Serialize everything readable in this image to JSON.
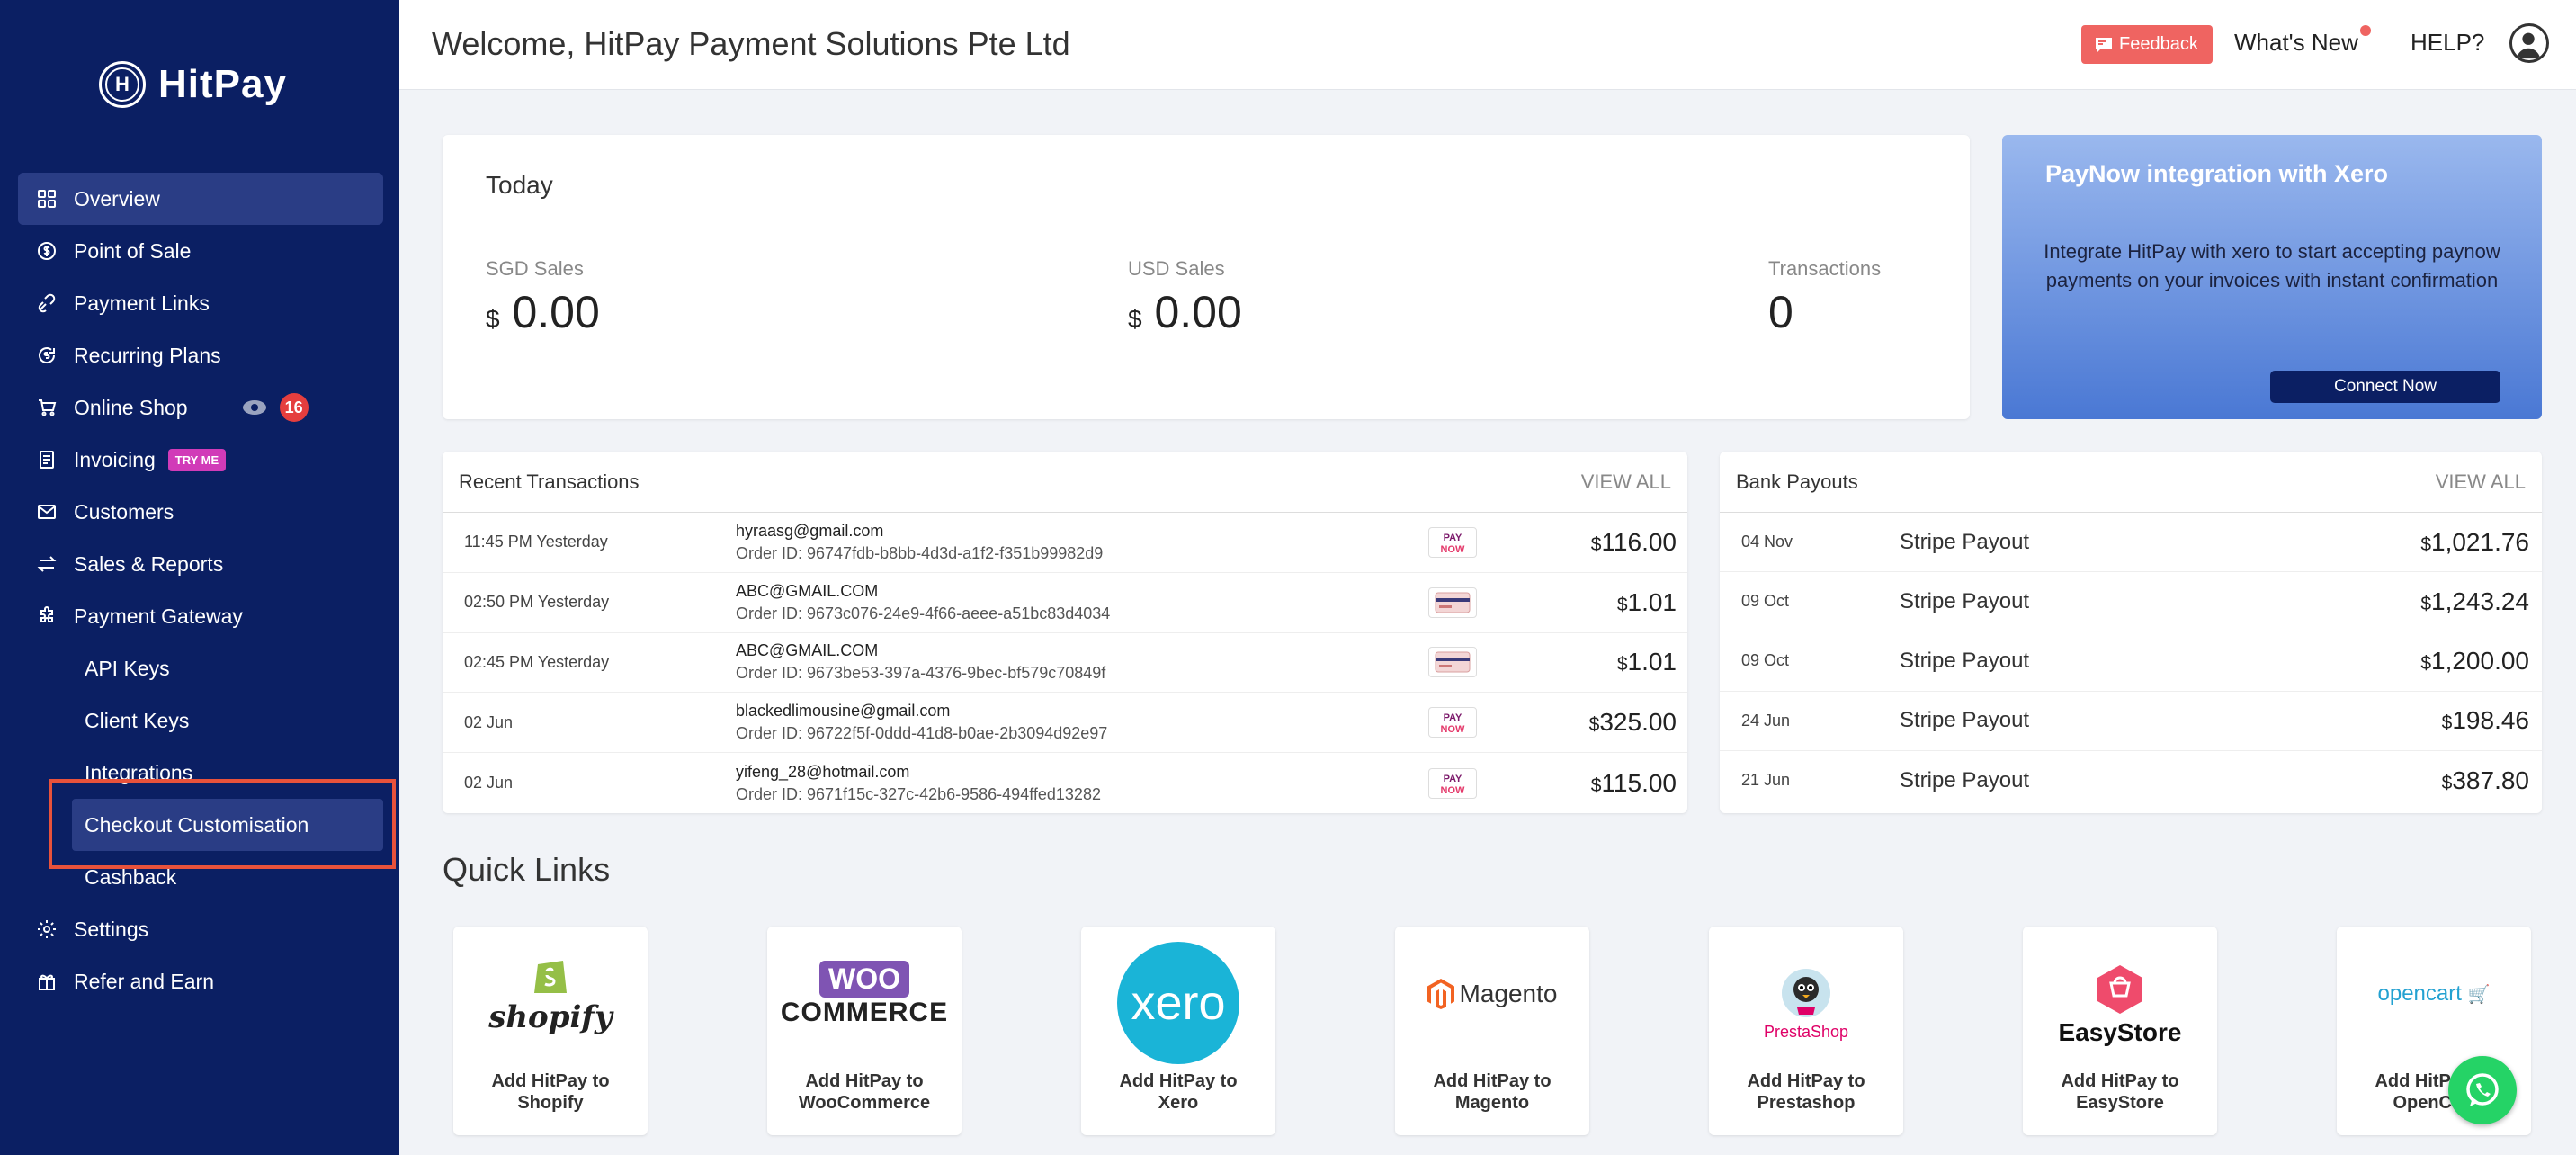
{
  "brand": {
    "name": "HitPay",
    "mark": "H"
  },
  "sidebar": {
    "items": [
      {
        "label": "Overview",
        "icon": "grid-icon"
      },
      {
        "label": "Point of Sale",
        "icon": "dollar-circle-icon"
      },
      {
        "label": "Payment Links",
        "icon": "link-icon"
      },
      {
        "label": "Recurring Plans",
        "icon": "recurring-icon"
      },
      {
        "label": "Online Shop",
        "icon": "cart-icon",
        "badge": "16"
      },
      {
        "label": "Invoicing",
        "icon": "invoice-icon",
        "tag": "TRY ME"
      },
      {
        "label": "Customers",
        "icon": "mail-icon"
      },
      {
        "label": "Sales & Reports",
        "icon": "arrows-icon"
      },
      {
        "label": "Payment Gateway",
        "icon": "puzzle-icon"
      }
    ],
    "sub_items": [
      "API Keys",
      "Client Keys",
      "Integrations",
      "Checkout Customisation",
      "Cashback"
    ],
    "bottom_items": [
      {
        "label": "Settings",
        "icon": "gear-icon"
      },
      {
        "label": "Refer and Earn",
        "icon": "gift-icon"
      }
    ]
  },
  "header": {
    "welcome": "Welcome, HitPay Payment Solutions Pte Ltd",
    "feedback": "Feedback",
    "whats_new": "What's New",
    "help": "HELP?"
  },
  "today": {
    "title": "Today",
    "sgd_label": "SGD Sales",
    "sgd_currency": "$",
    "sgd_value": "0.00",
    "usd_label": "USD Sales",
    "usd_currency": "$",
    "usd_value": "0.00",
    "tx_label": "Transactions",
    "tx_value": "0"
  },
  "promo": {
    "title": "PayNow integration with Xero",
    "body": "Integrate HitPay with xero to start accepting paynow payments on your invoices with instant confirmation",
    "button": "Connect Now"
  },
  "transactions": {
    "title": "Recent Transactions",
    "view_all": "VIEW ALL",
    "order_prefix": "Order ID: ",
    "rows": [
      {
        "time": "11:45 PM Yesterday",
        "email": "hyraasg@gmail.com",
        "order": "96747fdb-b8bb-4d3d-a1f2-f351b99982d9",
        "method": "paynow",
        "cur": "$",
        "amount": "116.00"
      },
      {
        "time": "02:50 PM Yesterday",
        "email": "ABC@GMAIL.COM",
        "order": "9673c076-24e9-4f66-aeee-a51bc83d4034",
        "method": "card",
        "cur": "$",
        "amount": "1.01"
      },
      {
        "time": "02:45 PM Yesterday",
        "email": "ABC@GMAIL.COM",
        "order": "9673be53-397a-4376-9bec-bf579c70849f",
        "method": "card",
        "cur": "$",
        "amount": "1.01"
      },
      {
        "time": "02 Jun",
        "email": "blackedlimousine@gmail.com",
        "order": "96722f5f-0ddd-41d8-b0ae-2b3094d92e97",
        "method": "paynow",
        "cur": "$",
        "amount": "325.00"
      },
      {
        "time": "02 Jun",
        "email": "yifeng_28@hotmail.com",
        "order": "9671f15c-327c-42b6-9586-494ffed13282",
        "method": "paynow",
        "cur": "$",
        "amount": "115.00"
      }
    ]
  },
  "payouts": {
    "title": "Bank Payouts",
    "view_all": "VIEW ALL",
    "rows": [
      {
        "date": "04 Nov",
        "desc": "Stripe Payout",
        "cur": "$",
        "amount": "1,021.76"
      },
      {
        "date": "09 Oct",
        "desc": "Stripe Payout",
        "cur": "$",
        "amount": "1,243.24"
      },
      {
        "date": "09 Oct",
        "desc": "Stripe Payout",
        "cur": "$",
        "amount": "1,200.00"
      },
      {
        "date": "24 Jun",
        "desc": "Stripe Payout",
        "cur": "$",
        "amount": "198.46"
      },
      {
        "date": "21 Jun",
        "desc": "Stripe Payout",
        "cur": "$",
        "amount": "387.80"
      }
    ]
  },
  "quick_links": {
    "title": "Quick Links",
    "items": [
      {
        "label1": "Add HitPay to",
        "label2": "Shopify",
        "logo": "shopify"
      },
      {
        "label1": "Add HitPay to",
        "label2": "WooCommerce",
        "logo_top": "WOO",
        "logo_bottom": "COMMERCE"
      },
      {
        "label1": "Add HitPay to",
        "label2": "Xero",
        "logo": "xero"
      },
      {
        "label1": "Add HitPay to",
        "label2": "Magento",
        "logo": "Magento"
      },
      {
        "label1": "Add HitPay to",
        "label2": "Prestashop",
        "logo": "PrestaShop"
      },
      {
        "label1": "Add HitPay to",
        "label2": "EasyStore",
        "logo": "EasyStore"
      },
      {
        "label1": "Add HitPay to",
        "label2": "OpenCart",
        "logo": "opencart"
      }
    ]
  },
  "colors": {
    "sidebar": "#0b1f63",
    "accent": "#ef6461",
    "badge": "#e53e3e",
    "tryme": "#d13bb8",
    "whatsapp": "#25d366"
  }
}
